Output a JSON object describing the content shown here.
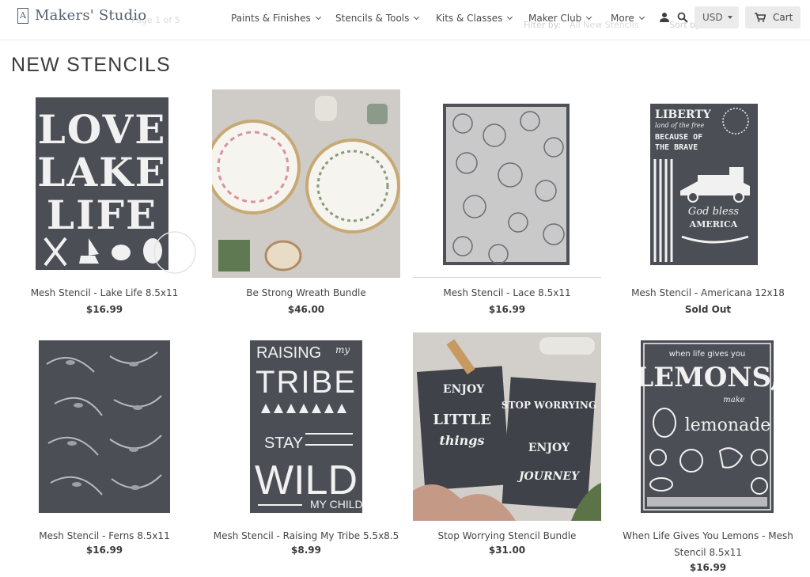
{
  "header": {
    "logo_mark": "A",
    "logo_text": "Makers' Studio",
    "page_indicator": "Page 1 of 5",
    "filter_label": "Filter by:",
    "filter_value": "All New Stencils",
    "sort_label": "Sort by",
    "nav": [
      {
        "label": "Paints & Finishes"
      },
      {
        "label": "Stencils & Tools"
      },
      {
        "label": "Kits & Classes"
      },
      {
        "label": "Maker Club"
      },
      {
        "label": "More"
      }
    ],
    "currency": "USD",
    "cart_label": "Cart"
  },
  "page": {
    "title": "NEW STENCILS"
  },
  "products": [
    {
      "name": "Mesh Stencil - Lake Life 8.5x11",
      "price": "$16.99",
      "art": [
        "LOVE",
        "LAKE",
        "LIFE"
      ]
    },
    {
      "name": "Be Strong Wreath Bundle",
      "price": "$46.00"
    },
    {
      "name": "Mesh Stencil - Lace 8.5x11",
      "price": "$16.99"
    },
    {
      "name": "Mesh Stencil - Americana 12x18",
      "price": "Sold Out",
      "art": [
        "LIBERTY",
        "land of the free",
        "BECAUSE OF",
        "THE BRAVE",
        "God bless",
        "AMERICA"
      ]
    },
    {
      "name": "Mesh Stencil - Ferns 8.5x11",
      "price": "$16.99"
    },
    {
      "name": "Mesh Stencil - Raising My Tribe 5.5x8.5",
      "price": "$8.99",
      "art": [
        "RAISING",
        "my",
        "TRIBE",
        "STAY",
        "WILD",
        "MY CHILD"
      ]
    },
    {
      "name": "Stop Worrying Stencil Bundle",
      "price": "$31.00",
      "art": [
        "ENJOY",
        "LITTLE",
        "things",
        "STOP WORRYING",
        "ENJOY",
        "JOURNEY"
      ]
    },
    {
      "name": "When Life Gives You Lemons - Mesh Stencil 8.5x11",
      "price": "$16.99",
      "art": [
        "when life gives you",
        "LEMONS,",
        "make",
        "lemonade"
      ]
    }
  ],
  "colors": {
    "stencil": "#4b4e55",
    "stencil_ink": "#f1f1f1",
    "button_bg": "#ebebeb"
  },
  "icons": [
    "chevron-down-icon",
    "user-icon",
    "search-icon",
    "caret-down-icon",
    "cart-icon"
  ]
}
